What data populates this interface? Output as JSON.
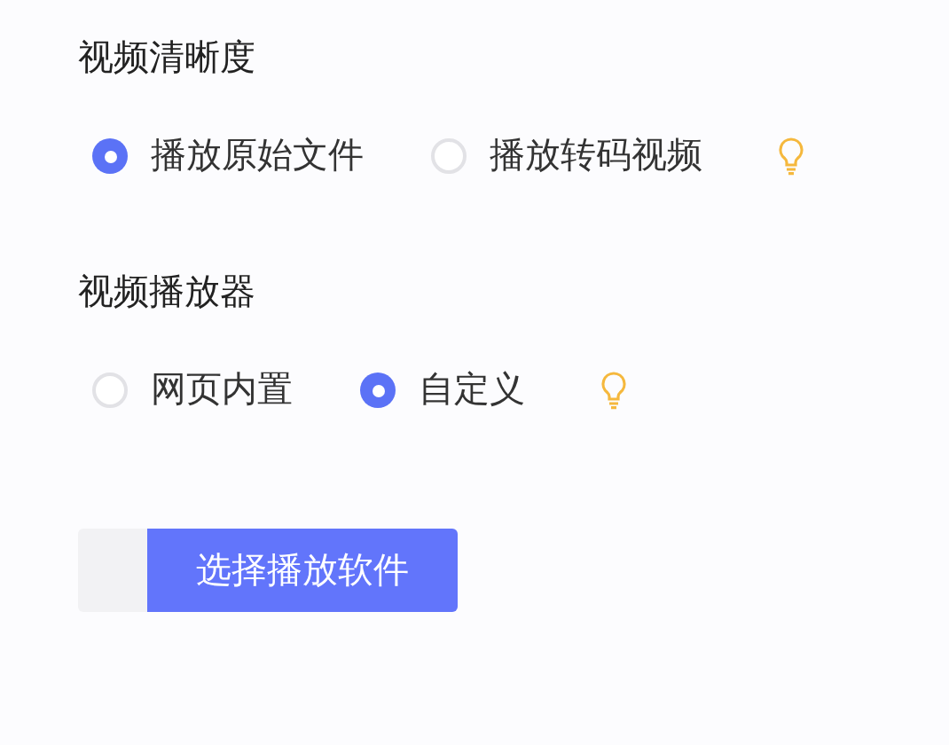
{
  "sections": [
    {
      "title": "视频清晰度",
      "options": [
        {
          "label": "播放原始文件",
          "selected": true
        },
        {
          "label": "播放转码视频",
          "selected": false
        }
      ],
      "hint": true
    },
    {
      "title": "视频播放器",
      "options": [
        {
          "label": "网页内置",
          "selected": false
        },
        {
          "label": "自定义",
          "selected": true
        }
      ],
      "hint": true
    }
  ],
  "choose_button": {
    "label": "选择播放软件"
  }
}
